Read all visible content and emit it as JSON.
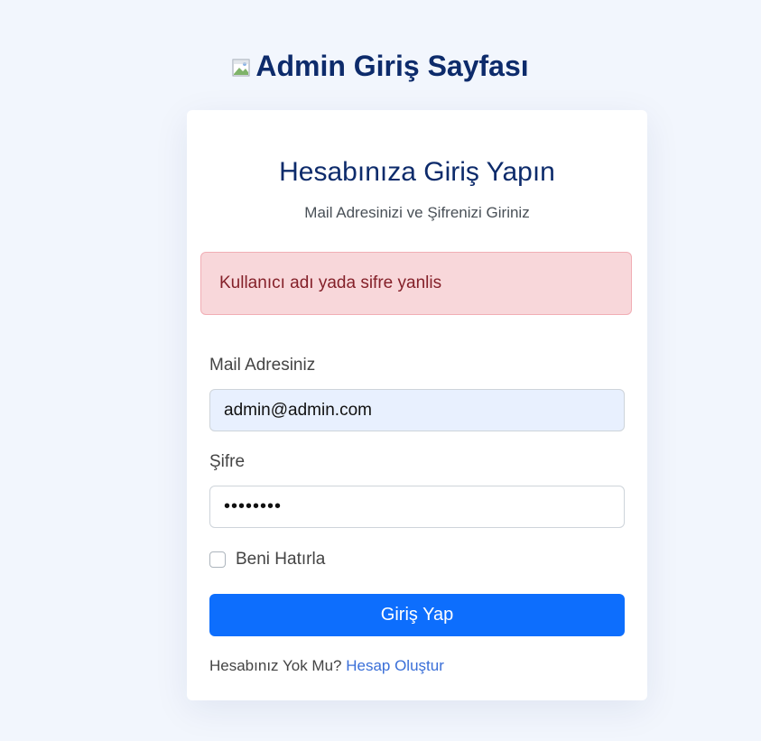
{
  "header": {
    "title": "Admin Giriş Sayfası",
    "logo_icon": "broken-image-icon"
  },
  "card": {
    "title": "Hesabınıza Giriş Yapın",
    "subtitle": "Mail Adresinizi ve Şifrenizi Giriniz",
    "alert_text": "Kullanıcı adı yada sifre yanlis"
  },
  "form": {
    "email_label": "Mail Adresiniz",
    "email_value": "admin@admin.com",
    "password_label": "Şifre",
    "password_value": "••••••••",
    "remember_label": "Beni Hatırla",
    "remember_checked": false,
    "submit_label": "Giriş Yap"
  },
  "footer": {
    "prompt": "Hesabınız Yok Mu?",
    "signup_link": "Hesap Oluştur"
  },
  "colors": {
    "background": "#f2f6fd",
    "title": "#0d2b6b",
    "primary": "#0d6efd",
    "alert_bg": "#f8d7da",
    "alert_text": "#842029",
    "autofill_bg": "#e8f0fe"
  }
}
